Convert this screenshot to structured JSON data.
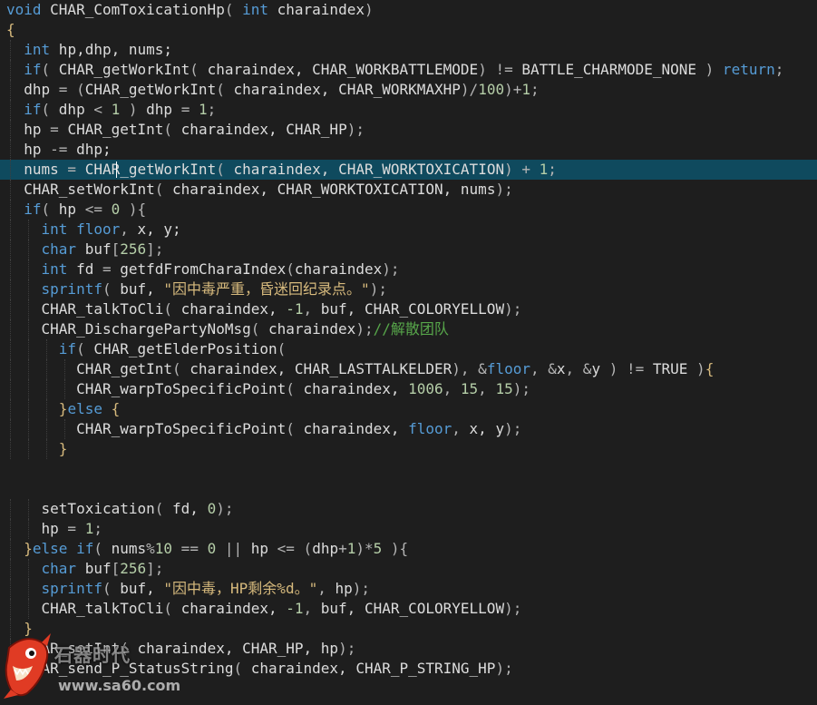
{
  "editor": {
    "lines": [
      {
        "indent": 0,
        "tokens": [
          [
            "kw",
            "void"
          ],
          [
            "id",
            " CHAR_ComToxicationHp"
          ],
          [
            "op",
            "( "
          ],
          [
            "kw",
            "int"
          ],
          [
            "id",
            " charaindex"
          ],
          [
            "op",
            ")"
          ]
        ]
      },
      {
        "indent": 0,
        "tokens": [
          [
            "brk",
            "{"
          ]
        ]
      },
      {
        "indent": 1,
        "tokens": [
          [
            "kw",
            "int"
          ],
          [
            "id",
            " hp,dhp, nums;"
          ]
        ]
      },
      {
        "indent": 1,
        "tokens": [
          [
            "kw",
            "if"
          ],
          [
            "op",
            "( "
          ],
          [
            "id",
            "CHAR_getWorkInt"
          ],
          [
            "op",
            "( "
          ],
          [
            "id",
            "charaindex, CHAR_WORKBATTLEMODE"
          ],
          [
            "op",
            ") != "
          ],
          [
            "id",
            "BATTLE_CHARMODE_NONE "
          ],
          [
            "op",
            ")"
          ],
          [
            "kw",
            " return"
          ],
          [
            "op",
            ";"
          ]
        ]
      },
      {
        "indent": 1,
        "tokens": [
          [
            "id",
            "dhp"
          ],
          [
            "op",
            " = ("
          ],
          [
            "id",
            "CHAR_getWorkInt"
          ],
          [
            "op",
            "( "
          ],
          [
            "id",
            "charaindex, CHAR_WORKMAXHP"
          ],
          [
            "op",
            ")/"
          ],
          [
            "num",
            "100"
          ],
          [
            "op",
            ")+"
          ],
          [
            "num",
            "1"
          ],
          [
            "op",
            ";"
          ]
        ]
      },
      {
        "indent": 1,
        "tokens": [
          [
            "kw",
            "if"
          ],
          [
            "op",
            "( "
          ],
          [
            "id",
            "dhp"
          ],
          [
            "op",
            " < "
          ],
          [
            "num",
            "1"
          ],
          [
            "op",
            " ) "
          ],
          [
            "id",
            "dhp"
          ],
          [
            "op",
            " = "
          ],
          [
            "num",
            "1"
          ],
          [
            "op",
            ";"
          ]
        ]
      },
      {
        "indent": 1,
        "tokens": [
          [
            "id",
            "hp"
          ],
          [
            "op",
            " = "
          ],
          [
            "id",
            "CHAR_getInt"
          ],
          [
            "op",
            "( "
          ],
          [
            "id",
            "charaindex, CHAR_HP"
          ],
          [
            "op",
            ");"
          ]
        ]
      },
      {
        "indent": 1,
        "tokens": [
          [
            "id",
            "hp"
          ],
          [
            "op",
            " -= "
          ],
          [
            "id",
            "dhp;"
          ]
        ]
      },
      {
        "indent": 1,
        "current": true,
        "tokens": [
          [
            "id",
            "nums"
          ],
          [
            "op",
            " = "
          ],
          [
            "id",
            "CHAR_getWorkInt"
          ],
          [
            "op",
            "( "
          ],
          [
            "id",
            "charaindex, CHAR_WORKTOXICATION"
          ],
          [
            "op",
            ") + "
          ],
          [
            "num",
            "1"
          ],
          [
            "op",
            ";"
          ]
        ]
      },
      {
        "indent": 1,
        "tokens": [
          [
            "id",
            "CHAR_setWorkInt"
          ],
          [
            "op",
            "( "
          ],
          [
            "id",
            "charaindex, CHAR_WORKTOXICATION, nums"
          ],
          [
            "op",
            ");"
          ]
        ]
      },
      {
        "indent": 1,
        "tokens": [
          [
            "kw",
            "if"
          ],
          [
            "op",
            "( "
          ],
          [
            "id",
            "hp"
          ],
          [
            "op",
            " <= "
          ],
          [
            "num",
            "0"
          ],
          [
            "op",
            " ){"
          ]
        ]
      },
      {
        "indent": 2,
        "tokens": [
          [
            "kw",
            "int"
          ],
          [
            "kw",
            " floor"
          ],
          [
            "op",
            ", "
          ],
          [
            "id",
            "x, y;"
          ]
        ]
      },
      {
        "indent": 2,
        "tokens": [
          [
            "kw",
            "char"
          ],
          [
            "id",
            " buf"
          ],
          [
            "op",
            "["
          ],
          [
            "num",
            "256"
          ],
          [
            "op",
            "];"
          ]
        ]
      },
      {
        "indent": 2,
        "tokens": [
          [
            "kw",
            "int"
          ],
          [
            "id",
            " fd"
          ],
          [
            "op",
            " = "
          ],
          [
            "id",
            "getfdFromCharaIndex"
          ],
          [
            "op",
            "("
          ],
          [
            "id",
            "charaindex"
          ],
          [
            "op",
            ");"
          ]
        ]
      },
      {
        "indent": 2,
        "tokens": [
          [
            "kw",
            "sprintf"
          ],
          [
            "op",
            "( "
          ],
          [
            "id",
            "buf, "
          ],
          [
            "str",
            "\"因中毒严重，昏迷回纪录点。\""
          ],
          [
            "op",
            ");"
          ]
        ]
      },
      {
        "indent": 2,
        "tokens": [
          [
            "id",
            "CHAR_talkToCli"
          ],
          [
            "op",
            "( "
          ],
          [
            "id",
            "charaindex, "
          ],
          [
            "num",
            "-1"
          ],
          [
            "op",
            ", "
          ],
          [
            "id",
            "buf, CHAR_COLORYELLOW"
          ],
          [
            "op",
            ");"
          ]
        ]
      },
      {
        "indent": 2,
        "tokens": [
          [
            "id",
            "CHAR_DischargePartyNoMsg"
          ],
          [
            "op",
            "( "
          ],
          [
            "id",
            "charaindex"
          ],
          [
            "op",
            ");"
          ],
          [
            "cmt",
            "//解散团队"
          ]
        ]
      },
      {
        "indent": 3,
        "tokens": [
          [
            "kw",
            "if"
          ],
          [
            "op",
            "( "
          ],
          [
            "id",
            "CHAR_getElderPosition"
          ],
          [
            "op",
            "("
          ]
        ]
      },
      {
        "indent": 4,
        "tokens": [
          [
            "id",
            "CHAR_getInt"
          ],
          [
            "op",
            "( "
          ],
          [
            "id",
            "charaindex, CHAR_LASTTALKELDER"
          ],
          [
            "op",
            "), &"
          ],
          [
            "kw",
            "floor"
          ],
          [
            "op",
            ", &"
          ],
          [
            "id",
            "x"
          ],
          [
            "op",
            ", &"
          ],
          [
            "id",
            "y "
          ],
          [
            "op",
            ") != "
          ],
          [
            "id",
            "TRUE "
          ],
          [
            "op",
            ")"
          ],
          [
            "brk",
            "{"
          ]
        ]
      },
      {
        "indent": 4,
        "tokens": [
          [
            "id",
            "CHAR_warpToSpecificPoint"
          ],
          [
            "op",
            "( "
          ],
          [
            "id",
            "charaindex, "
          ],
          [
            "num",
            "1006"
          ],
          [
            "op",
            ", "
          ],
          [
            "num",
            "15"
          ],
          [
            "op",
            ", "
          ],
          [
            "num",
            "15"
          ],
          [
            "op",
            ");"
          ]
        ]
      },
      {
        "indent": 3,
        "tokens": [
          [
            "brk",
            "}"
          ],
          [
            "kw",
            "else"
          ],
          [
            "brk",
            " {"
          ]
        ]
      },
      {
        "indent": 4,
        "tokens": [
          [
            "id",
            "CHAR_warpToSpecificPoint"
          ],
          [
            "op",
            "( "
          ],
          [
            "id",
            "charaindex, "
          ],
          [
            "kw",
            "floor"
          ],
          [
            "op",
            ", "
          ],
          [
            "id",
            "x, y"
          ],
          [
            "op",
            ");"
          ]
        ]
      },
      {
        "indent": 3,
        "tokens": [
          [
            "brk",
            "}"
          ]
        ]
      },
      {
        "indent": 0,
        "tokens": []
      },
      {
        "indent": 0,
        "tokens": []
      },
      {
        "indent": 2,
        "tokens": [
          [
            "id",
            "setToxication"
          ],
          [
            "op",
            "( "
          ],
          [
            "id",
            "fd, "
          ],
          [
            "num",
            "0"
          ],
          [
            "op",
            ");"
          ]
        ]
      },
      {
        "indent": 2,
        "tokens": [
          [
            "id",
            "hp"
          ],
          [
            "op",
            " = "
          ],
          [
            "num",
            "1"
          ],
          [
            "op",
            ";"
          ]
        ]
      },
      {
        "indent": 1,
        "tokens": [
          [
            "brk",
            "}"
          ],
          [
            "kw",
            "else if"
          ],
          [
            "op",
            "( "
          ],
          [
            "id",
            "nums"
          ],
          [
            "op",
            "%"
          ],
          [
            "num",
            "10"
          ],
          [
            "op",
            " == "
          ],
          [
            "num",
            "0"
          ],
          [
            "op",
            " || "
          ],
          [
            "id",
            "hp"
          ],
          [
            "op",
            " <= ("
          ],
          [
            "id",
            "dhp"
          ],
          [
            "op",
            "+"
          ],
          [
            "num",
            "1"
          ],
          [
            "op",
            ")*"
          ],
          [
            "num",
            "5"
          ],
          [
            "op",
            " ){"
          ]
        ]
      },
      {
        "indent": 2,
        "tokens": [
          [
            "kw",
            "char"
          ],
          [
            "id",
            " buf"
          ],
          [
            "op",
            "["
          ],
          [
            "num",
            "256"
          ],
          [
            "op",
            "];"
          ]
        ]
      },
      {
        "indent": 2,
        "tokens": [
          [
            "kw",
            "sprintf"
          ],
          [
            "op",
            "( "
          ],
          [
            "id",
            "buf, "
          ],
          [
            "str",
            "\"因中毒，HP剩余%d。\""
          ],
          [
            "op",
            ", "
          ],
          [
            "id",
            "hp"
          ],
          [
            "op",
            ");"
          ]
        ]
      },
      {
        "indent": 2,
        "tokens": [
          [
            "id",
            "CHAR_talkToCli"
          ],
          [
            "op",
            "( "
          ],
          [
            "id",
            "charaindex, "
          ],
          [
            "num",
            "-1"
          ],
          [
            "op",
            ", "
          ],
          [
            "id",
            "buf, CHAR_COLORYELLOW"
          ],
          [
            "op",
            ");"
          ]
        ]
      },
      {
        "indent": 1,
        "tokens": [
          [
            "brk",
            "}"
          ]
        ]
      },
      {
        "indent": 1,
        "tokens": [
          [
            "id",
            "CHAR_setInt"
          ],
          [
            "op",
            "( "
          ],
          [
            "id",
            "charaindex, CHAR_HP, hp"
          ],
          [
            "op",
            ");"
          ]
        ]
      },
      {
        "indent": 1,
        "tokens": [
          [
            "id",
            "CHAR_send_P_StatusString"
          ],
          [
            "op",
            "( "
          ],
          [
            "id",
            "charaindex, CHAR_P_STRING_HP"
          ],
          [
            "op",
            ");"
          ]
        ]
      }
    ]
  },
  "watermark": {
    "title": "石器时代",
    "url": "www.sa60.com",
    "logo_icon": "red-shark-mascot-icon"
  },
  "colors": {
    "background": "#1e1e1e",
    "current_line": "#0f4a5e",
    "keyword": "#569cd6",
    "number": "#b5cea8",
    "string": "#d7ba7d",
    "comment": "#57a64a"
  }
}
